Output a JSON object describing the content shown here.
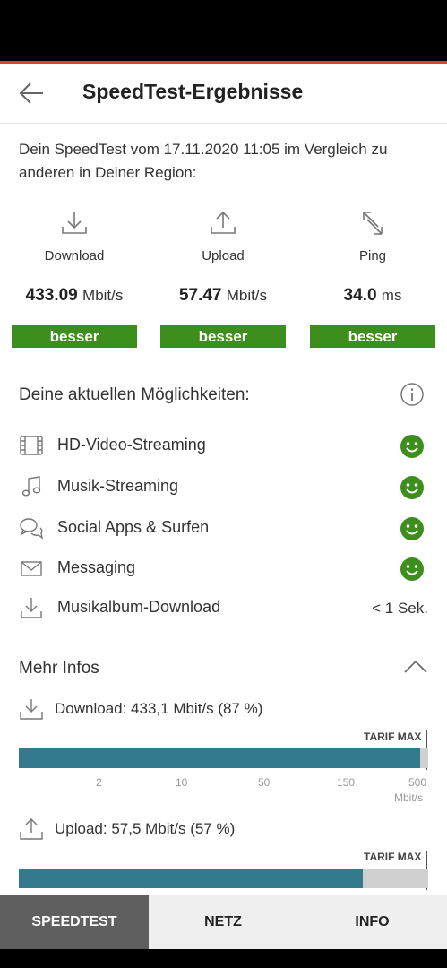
{
  "header": {
    "title": "SpeedTest-Ergebnisse"
  },
  "intro": "Dein SpeedTest vom 17.11.2020 11:05 im Vergleich zu anderen in Deiner Region:",
  "metrics": [
    {
      "label": "Download",
      "value": "433.09",
      "unit": "Mbit/s",
      "badge": "besser",
      "icon": "download-icon"
    },
    {
      "label": "Upload",
      "value": "57.47",
      "unit": "Mbit/s",
      "badge": "besser",
      "icon": "upload-icon"
    },
    {
      "label": "Ping",
      "value": "34.0",
      "unit": "ms",
      "badge": "besser",
      "icon": "ping-icon"
    }
  ],
  "capabilities": {
    "title": "Deine aktuellen Möglichkeiten:",
    "items": [
      {
        "label": "HD-Video-Streaming",
        "icon": "film-icon",
        "status": "smiley"
      },
      {
        "label": "Musik-Streaming",
        "icon": "music-note-icon",
        "status": "smiley"
      },
      {
        "label": "Social Apps & Surfen",
        "icon": "chat-bubbles-icon",
        "status": "smiley"
      },
      {
        "label": "Messaging",
        "icon": "envelope-icon",
        "status": "smiley"
      },
      {
        "label": "Musikalbum-Download",
        "icon": "download-icon",
        "value": "< 1 Sek."
      }
    ]
  },
  "more_info": {
    "title": "Mehr Infos",
    "download": {
      "text": "Download: 433,1 Mbit/s (87 %)",
      "percent": 87
    },
    "upload": {
      "text": "Upload: 57,5 Mbit/s (57 %)",
      "percent": 57
    },
    "tarif_label": "TARIF MAX",
    "scale_ticks": [
      "2",
      "10",
      "50",
      "150",
      "500"
    ],
    "scale_unit": "Mbit/s"
  },
  "tabs": [
    {
      "label": "SPEEDTEST",
      "active": true
    },
    {
      "label": "NETZ",
      "active": false
    },
    {
      "label": "INFO",
      "active": false
    }
  ],
  "colors": {
    "accent": "#d8452b",
    "badge": "#3e8e1e",
    "bar_fill": "#337a8e",
    "smiley": "#3e8e1e",
    "active_tab": "#5f5f5f"
  }
}
